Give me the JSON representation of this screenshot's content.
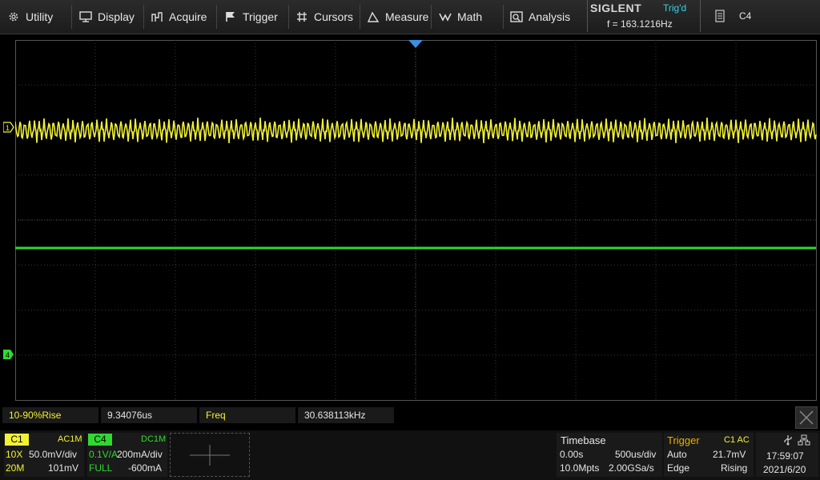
{
  "menu": [
    {
      "label": "Utility",
      "icon": "gear-icon"
    },
    {
      "label": "Display",
      "icon": "monitor-icon"
    },
    {
      "label": "Acquire",
      "icon": "acquire-icon"
    },
    {
      "label": "Trigger",
      "icon": "flag-icon"
    },
    {
      "label": "Cursors",
      "icon": "crosshair-icon"
    },
    {
      "label": "Measure",
      "icon": "measure-icon"
    },
    {
      "label": "Math",
      "icon": "math-icon"
    },
    {
      "label": "Analysis",
      "icon": "analysis-icon"
    }
  ],
  "header": {
    "brand": "SIGLENT",
    "trig_status": "Trig'd",
    "frequency": "f = 163.1216Hz",
    "channel": "C4"
  },
  "markers": {
    "ch1": "1",
    "ch4": "4"
  },
  "measurements": [
    {
      "label": "10-90%Rise",
      "value": "9.34076us"
    },
    {
      "label": "Freq",
      "value": "30.638113kHz"
    }
  ],
  "ch1": {
    "name": "C1",
    "coupling": "AC1M",
    "probe": "10X",
    "scale": "50.0mV/div",
    "bw": "20M",
    "offset": "101mV"
  },
  "ch4": {
    "name": "C4",
    "coupling": "DC1M",
    "probe": "0.1V/A",
    "scale": "200mA/div",
    "bw": "FULL",
    "offset": "-600mA"
  },
  "timebase": {
    "title": "Timebase",
    "delay": "0.00s",
    "scale": "500us/div",
    "memory": "10.0Mpts",
    "rate": "2.00GSa/s"
  },
  "trigger": {
    "title": "Trigger",
    "source": "C1 AC",
    "mode": "Auto",
    "level": "21.7mV",
    "type": "Edge",
    "slope": "Rising"
  },
  "clock": {
    "time": "17:59:07",
    "date": "2021/6/20"
  },
  "colors": {
    "ch1": "#f2f232",
    "ch4": "#2fd92f",
    "grid": "#3a3a3a",
    "trigger_accent": "#e8b000",
    "accent_blue": "#34d3e6"
  }
}
